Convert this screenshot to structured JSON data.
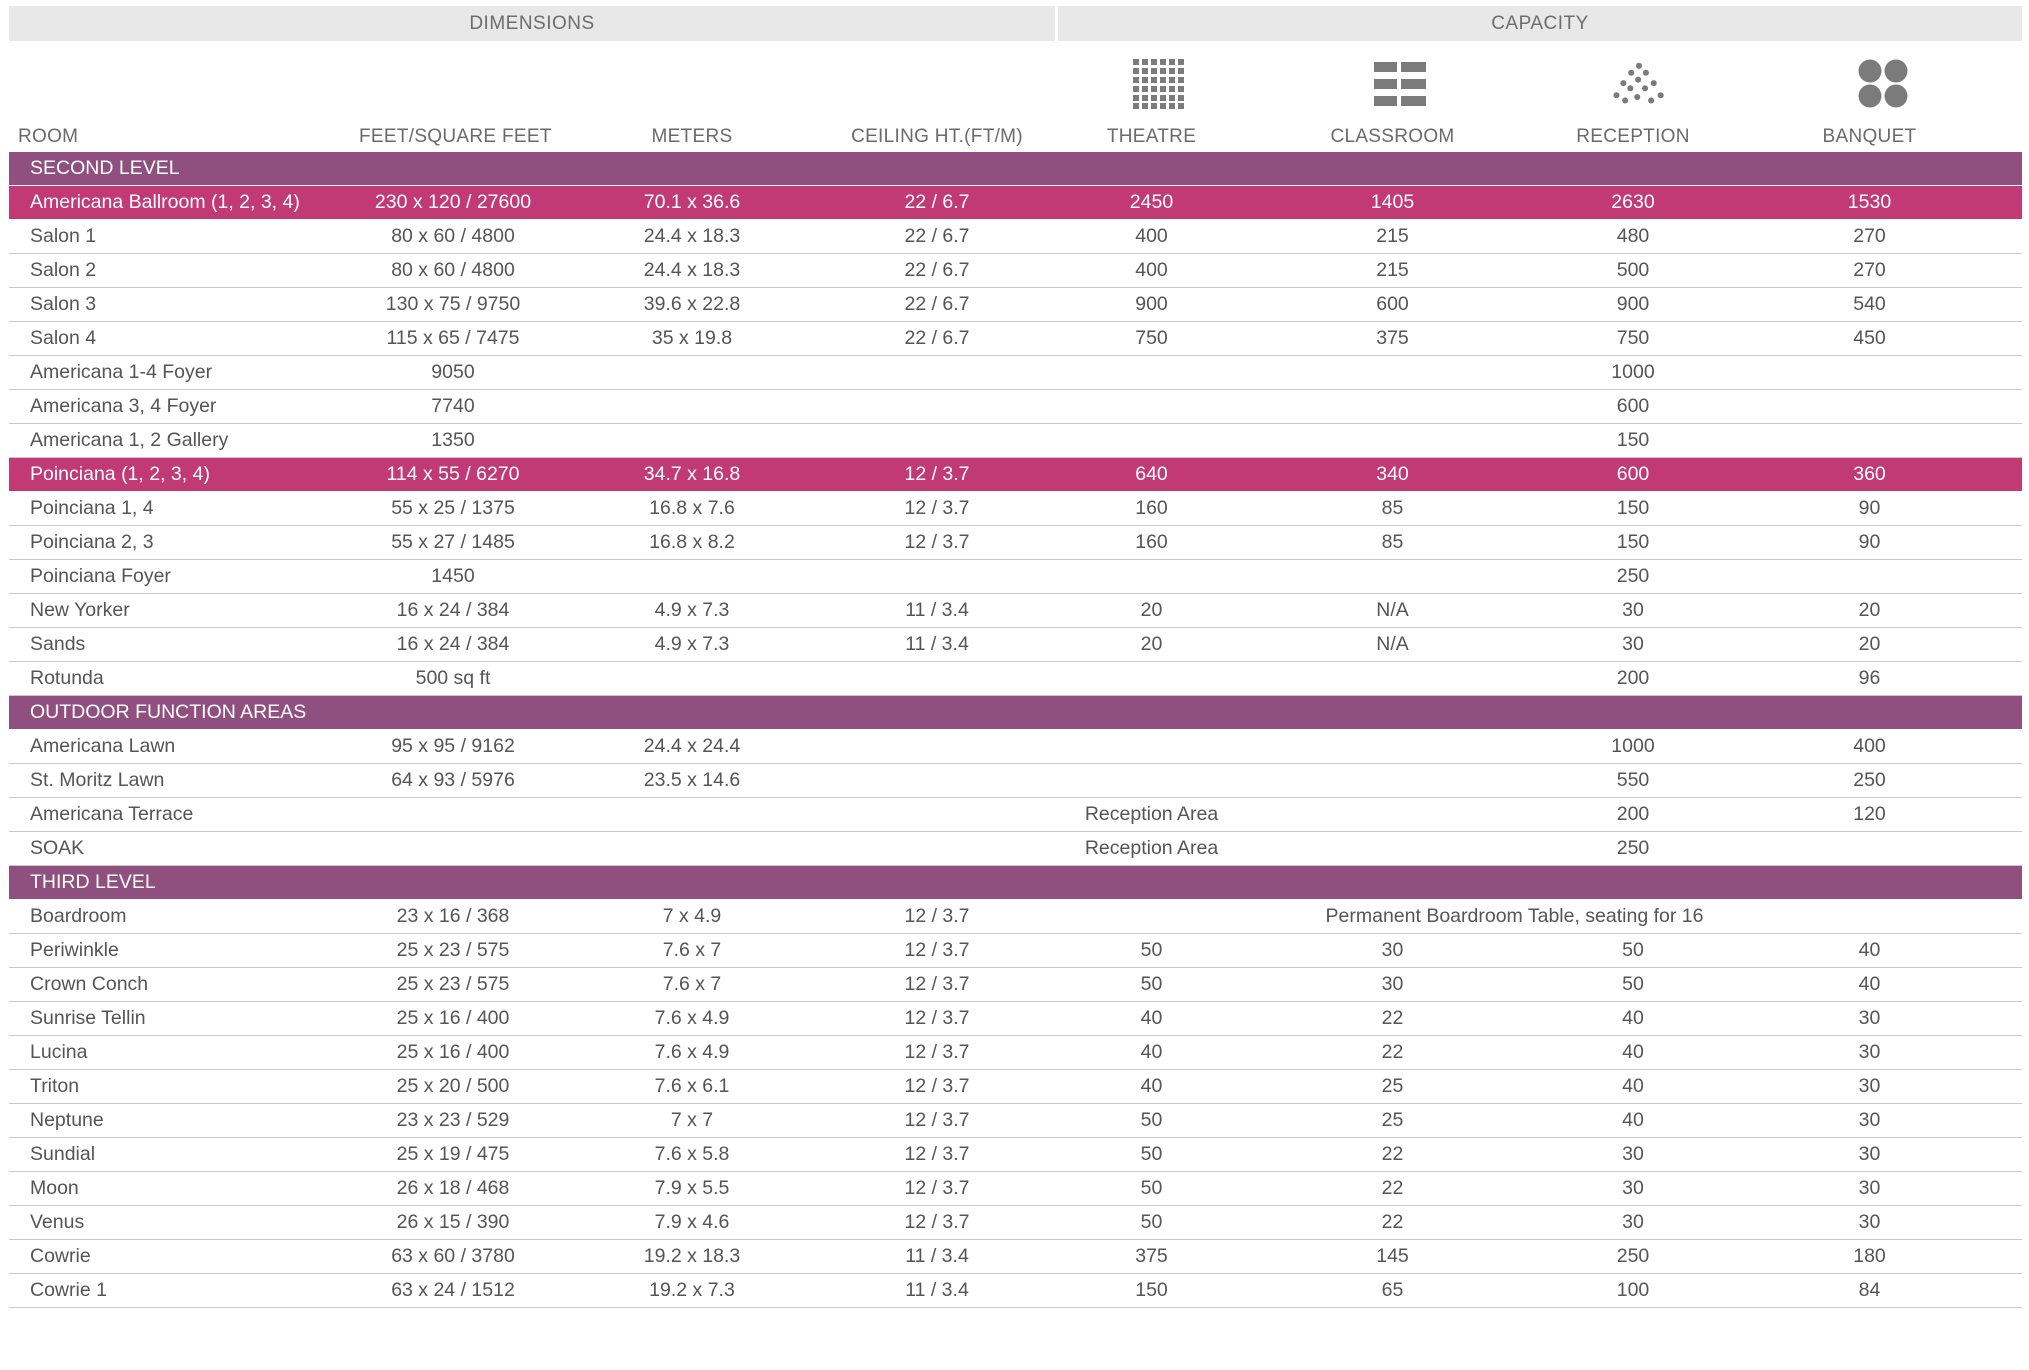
{
  "groups": {
    "dimensions": "DIMENSIONS",
    "capacity": "CAPACITY"
  },
  "columns": {
    "room": "ROOM",
    "feet": "FEET/SQUARE FEET",
    "meters": "METERS",
    "ceiling": "CEILING HT.(FT/M)",
    "theatre": "THEATRE",
    "classroom": "CLASSROOM",
    "reception": "RECEPTION",
    "banquet": "BANQUET"
  },
  "icons": {
    "theatre": "theatre-seating-grid-icon",
    "classroom": "classroom-tables-icon",
    "reception": "reception-dots-icon",
    "banquet": "banquet-round-tables-icon"
  },
  "colors": {
    "section": "#90507f",
    "highlight": "#c23a75",
    "header_band": "#e8e8e9",
    "icon": "#7b7b7b"
  },
  "rows": [
    {
      "type": "section",
      "title": "SECOND LEVEL"
    },
    {
      "type": "highlight",
      "room": "Americana Ballroom (1, 2, 3, 4)",
      "feet": "230 x 120 / 27600",
      "meters": "70.1 x 36.6",
      "ceiling": "22 / 6.7",
      "theatre": "2450",
      "classroom": "1405",
      "reception": "2630",
      "banquet": "1530"
    },
    {
      "type": "data",
      "room": "Salon 1",
      "feet": "80 x 60 / 4800",
      "meters": "24.4 x 18.3",
      "ceiling": "22 / 6.7",
      "theatre": "400",
      "classroom": "215",
      "reception": "480",
      "banquet": "270"
    },
    {
      "type": "data",
      "room": "Salon 2",
      "feet": "80 x 60 / 4800",
      "meters": "24.4 x 18.3",
      "ceiling": "22 / 6.7",
      "theatre": "400",
      "classroom": "215",
      "reception": "500",
      "banquet": "270"
    },
    {
      "type": "data",
      "room": "Salon 3",
      "feet": "130 x 75 / 9750",
      "meters": "39.6 x 22.8",
      "ceiling": "22 / 6.7",
      "theatre": "900",
      "classroom": "600",
      "reception": "900",
      "banquet": "540"
    },
    {
      "type": "data",
      "room": "Salon 4",
      "feet": "115 x 65 / 7475",
      "meters": "35 x 19.8",
      "ceiling": "22 / 6.7",
      "theatre": "750",
      "classroom": "375",
      "reception": "750",
      "banquet": "450"
    },
    {
      "type": "data",
      "room": "Americana 1-4 Foyer",
      "feet": "9050",
      "meters": "",
      "ceiling": "",
      "theatre": "",
      "classroom": "",
      "reception": "1000",
      "banquet": ""
    },
    {
      "type": "data",
      "room": "Americana 3, 4 Foyer",
      "feet": "7740",
      "meters": "",
      "ceiling": "",
      "theatre": "",
      "classroom": "",
      "reception": "600",
      "banquet": ""
    },
    {
      "type": "data",
      "room": "Americana 1, 2 Gallery",
      "feet": "1350",
      "meters": "",
      "ceiling": "",
      "theatre": "",
      "classroom": "",
      "reception": "150",
      "banquet": ""
    },
    {
      "type": "highlight",
      "room": "Poinciana (1, 2, 3, 4)",
      "feet": "114 x 55 / 6270",
      "meters": "34.7 x 16.8",
      "ceiling": "12 / 3.7",
      "theatre": "640",
      "classroom": "340",
      "reception": "600",
      "banquet": "360"
    },
    {
      "type": "data",
      "room": "Poinciana 1, 4",
      "feet": "55 x 25 / 1375",
      "meters": "16.8 x 7.6",
      "ceiling": "12 / 3.7",
      "theatre": "160",
      "classroom": "85",
      "reception": "150",
      "banquet": "90"
    },
    {
      "type": "data",
      "room": "Poinciana 2, 3",
      "feet": "55 x 27 / 1485",
      "meters": "16.8 x 8.2",
      "ceiling": "12 / 3.7",
      "theatre": "160",
      "classroom": "85",
      "reception": "150",
      "banquet": "90"
    },
    {
      "type": "data",
      "room": "Poinciana Foyer",
      "feet": "1450",
      "meters": "",
      "ceiling": "",
      "theatre": "",
      "classroom": "",
      "reception": "250",
      "banquet": ""
    },
    {
      "type": "data",
      "room": "New Yorker",
      "feet": "16 x 24 / 384",
      "meters": "4.9 x 7.3",
      "ceiling": "11 / 3.4",
      "theatre": "20",
      "classroom": "N/A",
      "reception": "30",
      "banquet": "20"
    },
    {
      "type": "data",
      "room": "Sands",
      "feet": "16 x 24 / 384",
      "meters": "4.9 x 7.3",
      "ceiling": "11 / 3.4",
      "theatre": "20",
      "classroom": "N/A",
      "reception": "30",
      "banquet": "20"
    },
    {
      "type": "data",
      "room": "Rotunda",
      "feet": "500 sq ft",
      "meters": "",
      "ceiling": "",
      "theatre": "",
      "classroom": "",
      "reception": "200",
      "banquet": "96"
    },
    {
      "type": "section",
      "title": "OUTDOOR FUNCTION AREAS"
    },
    {
      "type": "data",
      "room": "Americana Lawn",
      "feet": "95 x 95 / 9162",
      "meters": "24.4 x 24.4",
      "ceiling": "",
      "theatre": "",
      "classroom": "",
      "reception": "1000",
      "banquet": "400"
    },
    {
      "type": "data",
      "room": "St. Moritz Lawn",
      "feet": "64 x 93 / 5976",
      "meters": "23.5 x 14.6",
      "ceiling": "",
      "theatre": "",
      "classroom": "",
      "reception": "550",
      "banquet": "250"
    },
    {
      "type": "data",
      "room": "Americana Terrace",
      "feet": "",
      "meters": "",
      "ceiling": "",
      "theatre": "Reception Area",
      "classroom": "",
      "reception": "200",
      "banquet": "120"
    },
    {
      "type": "data",
      "room": "SOAK",
      "feet": "",
      "meters": "",
      "ceiling": "",
      "theatre": "Reception Area",
      "classroom": "",
      "reception": "250",
      "banquet": ""
    },
    {
      "type": "section",
      "title": "THIRD LEVEL"
    },
    {
      "type": "note",
      "room": "Boardroom",
      "feet": "23 x 16 / 368",
      "meters": "7 x 4.9",
      "ceiling": "12 / 3.7",
      "note": "Permanent Boardroom Table, seating for 16"
    },
    {
      "type": "data",
      "room": "Periwinkle",
      "feet": "25 x 23 / 575",
      "meters": "7.6 x 7",
      "ceiling": "12 / 3.7",
      "theatre": "50",
      "classroom": "30",
      "reception": "50",
      "banquet": "40"
    },
    {
      "type": "data",
      "room": "Crown Conch",
      "feet": "25 x 23 / 575",
      "meters": "7.6 x 7",
      "ceiling": "12 / 3.7",
      "theatre": "50",
      "classroom": "30",
      "reception": "50",
      "banquet": "40"
    },
    {
      "type": "data",
      "room": "Sunrise Tellin",
      "feet": "25 x 16 / 400",
      "meters": "7.6 x 4.9",
      "ceiling": "12 / 3.7",
      "theatre": "40",
      "classroom": "22",
      "reception": "40",
      "banquet": "30"
    },
    {
      "type": "data",
      "room": "Lucina",
      "feet": "25 x 16 / 400",
      "meters": "7.6 x 4.9",
      "ceiling": "12 / 3.7",
      "theatre": "40",
      "classroom": "22",
      "reception": "40",
      "banquet": "30"
    },
    {
      "type": "data",
      "room": "Triton",
      "feet": "25 x 20 / 500",
      "meters": "7.6 x 6.1",
      "ceiling": "12 / 3.7",
      "theatre": "40",
      "classroom": "25",
      "reception": "40",
      "banquet": "30"
    },
    {
      "type": "data",
      "room": "Neptune",
      "feet": "23 x 23 / 529",
      "meters": "7 x 7",
      "ceiling": "12 / 3.7",
      "theatre": "50",
      "classroom": "25",
      "reception": "40",
      "banquet": "30"
    },
    {
      "type": "data",
      "room": "Sundial",
      "feet": "25 x 19 / 475",
      "meters": "7.6 x 5.8",
      "ceiling": "12 / 3.7",
      "theatre": "50",
      "classroom": "22",
      "reception": "30",
      "banquet": "30"
    },
    {
      "type": "data",
      "room": "Moon",
      "feet": "26 x 18 / 468",
      "meters": "7.9 x 5.5",
      "ceiling": "12 / 3.7",
      "theatre": "50",
      "classroom": "22",
      "reception": "30",
      "banquet": "30"
    },
    {
      "type": "data",
      "room": "Venus",
      "feet": "26 x 15 / 390",
      "meters": "7.9 x 4.6",
      "ceiling": "12 / 3.7",
      "theatre": "50",
      "classroom": "22",
      "reception": "30",
      "banquet": "30"
    },
    {
      "type": "data",
      "room": "Cowrie",
      "feet": "63 x 60 / 3780",
      "meters": "19.2 x 18.3",
      "ceiling": "11 / 3.4",
      "theatre": "375",
      "classroom": "145",
      "reception": "250",
      "banquet": "180"
    },
    {
      "type": "data",
      "room": "Cowrie 1",
      "feet": "63 x 24 / 1512",
      "meters": "19.2 x 7.3",
      "ceiling": "11 / 3.4",
      "theatre": "150",
      "classroom": "65",
      "reception": "100",
      "banquet": "84"
    }
  ]
}
